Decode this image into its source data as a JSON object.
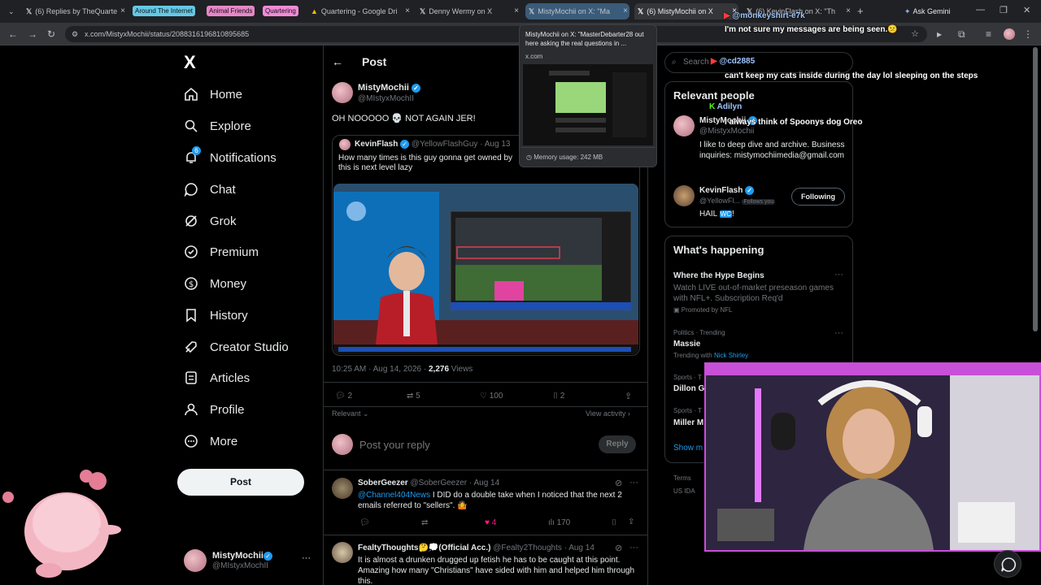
{
  "browser": {
    "tabs": [
      {
        "label": "(6) Replies by TheQuarte"
      },
      {
        "label": "Quartering - Google Dri"
      },
      {
        "label": "Denny Wermy on X"
      },
      {
        "label": "MistyMochii on X: \"Ma"
      },
      {
        "label": "(6) MistyMochii on X"
      },
      {
        "label": "(6) KevinFlash on X: \"Th"
      }
    ],
    "tab_groups": [
      {
        "label": "Around The Internet",
        "color": "#64c8e6"
      },
      {
        "label": "Animal Friends",
        "color": "#e687c8"
      },
      {
        "label": "Quartering",
        "color": "#f28ad8"
      }
    ],
    "new_tab": "+",
    "ask_gemini": "Ask Gemini",
    "url": "x.com/MistyxMochii/status/2088316196810895685",
    "preview": {
      "title": "MistyMochii on X: \"MasterDebarter28 out here asking the real questions in ...",
      "domain": "x.com",
      "memory": "Memory usage: 242 MB"
    }
  },
  "nav": {
    "logo": "X",
    "items": [
      {
        "label": "Home"
      },
      {
        "label": "Explore"
      },
      {
        "label": "Notifications"
      },
      {
        "label": "Chat"
      },
      {
        "label": "Grok"
      },
      {
        "label": "Premium"
      },
      {
        "label": "Money"
      },
      {
        "label": "History"
      },
      {
        "label": "Creator Studio"
      },
      {
        "label": "Articles"
      },
      {
        "label": "Profile"
      },
      {
        "label": "More"
      }
    ],
    "notif_count": "6",
    "post_button": "Post",
    "account": {
      "name": "MistyMochii",
      "handle": "@MIstyxMochII",
      "more": "···"
    }
  },
  "post": {
    "header_title": "Post",
    "author": "MistyMochii",
    "handle": "@MIstyxMochII",
    "text": "OH NOOOOO 💀 NOT AGAIN JER!",
    "quote": {
      "author": "KevinFlash",
      "handle": "@YellowFlashGuy",
      "date": "· Aug 13",
      "text": "How many times is this guy gonna get owned by this is next level lazy"
    },
    "timestamp": "10:25 AM · Aug 14, 2026 · ",
    "views": "2,276",
    "views_label": " Views",
    "actions": {
      "replies": "2",
      "reposts": "5",
      "likes": "100",
      "bookmarks": "2"
    },
    "relevant": "Relevant ⌄",
    "view_activity": "View activity ›",
    "reply_placeholder": "Post your reply",
    "reply_button": "Reply"
  },
  "replies": [
    {
      "author": "SoberGeezer",
      "handle": "@SoberGeezer",
      "date": "· Aug 14",
      "mention": "@Channel404News",
      "text": " I DID do a double take when I noticed that the next 2 emails referred to \"sellers\". 🤷",
      "likes": "4",
      "views": "170"
    },
    {
      "author": "FealtyThoughts🤔💭(Official Acc.)",
      "handle": "@Fealty2Thoughts",
      "date": "· Aug 14",
      "text": "It is almost a drunken drugged up fetish he has to be caught at this point. Amazing how many \"Christians\" have sided with him and helped him through this."
    }
  ],
  "sidebar": {
    "search": "Search",
    "relevant_title": "Relevant people",
    "people": [
      {
        "name": "MistyMochii",
        "handle": "@MistyxMochii",
        "bio": "I like to deep dive and archive. Business inquiries: mistymochiimedia@gmail.com"
      },
      {
        "name": "KevinFlash",
        "handle": "@YellowFl...",
        "follows_you": "Follows you",
        "bio_prefix": "HAIL ",
        "bio_tag": "WC",
        "bio_suffix": "!",
        "button": "Following"
      }
    ],
    "happening_title": "What's happening",
    "trends": [
      {
        "title": "Where the Hype Begins",
        "desc": "Watch LIVE out-of-market preseason games with NFL+. Subscription Req'd",
        "meta": "Promoted by NFL"
      },
      {
        "category": "Politics · Trending",
        "title": "Massie",
        "meta_prefix": "Trending with ",
        "meta_link": "Nick Shirley"
      },
      {
        "category": "Sports · T",
        "title": "Dillon G"
      },
      {
        "category": "Sports · T",
        "title": "Miller M"
      }
    ],
    "show_more": "Show m",
    "footer_1": "Terms",
    "footer_2": "US IDA"
  },
  "overlay": {
    "user1": "@monkeyshirt-e7k",
    "msg1": "I'm not sure my messages are being seen.😕",
    "user2": "@cd2885",
    "msg2": "can't keep my cats inside during the day lol sleeping on the steps",
    "user3": "Adilyn",
    "msg3": "I always think of Spoonys dog Oreo"
  }
}
